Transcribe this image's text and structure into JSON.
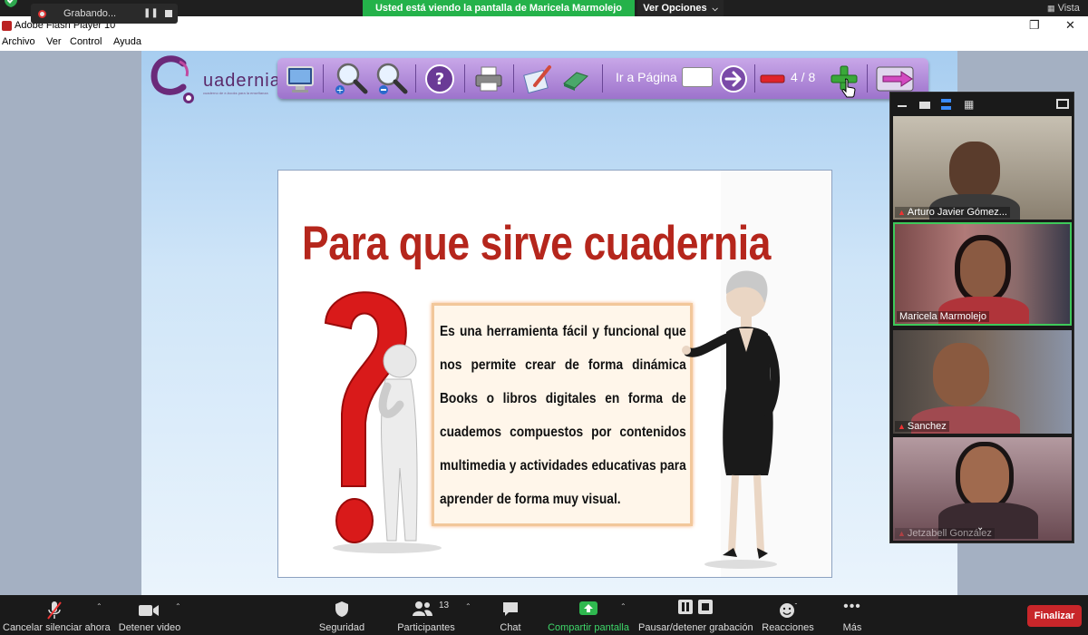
{
  "zoom": {
    "recording_label": "Grabando...",
    "banner": "Usted está viendo la pantalla de Maricela Marmolejo",
    "view_options": "Ver Opciones",
    "vista": "Vista"
  },
  "flash": {
    "title": "Adobe Flash Player 10",
    "menu": [
      "Archivo",
      "Ver",
      "Control",
      "Ayuda"
    ]
  },
  "cuadernia": {
    "logo_text": "uadernia",
    "logo_sub": "cuaderno de e-books para la enseñanza",
    "goto_label": "Ir a Página",
    "goto_value": "",
    "page_indicator": "4 / 8"
  },
  "slide": {
    "title": "Para que sirve cuadernia",
    "body": "Es una herramienta fácil y funcional que nos permite crear de forma dinámica Books o libros digitales en forma de cuademos compuestos por contenidos multimedia y actividades educativas para aprender de forma muy visual."
  },
  "participants": [
    {
      "name": "Arturo Javier Gómez...",
      "muted": true,
      "bg": "#8a8070"
    },
    {
      "name": "Maricela Marmolejo",
      "muted": false,
      "bg": "#9a5a55"
    },
    {
      "name": "Sanchez",
      "muted": true,
      "bg": "#6a6058"
    },
    {
      "name": "Jetzabell González",
      "muted": true,
      "bg": "#7a5a5e"
    }
  ],
  "bottom_bar": {
    "mute": "Cancelar silenciar ahora",
    "video": "Detener video",
    "security": "Seguridad",
    "participants": "Participantes",
    "participants_count": "13",
    "chat": "Chat",
    "share": "Compartir pantalla",
    "record": "Pausar/detener grabación",
    "reactions": "Reacciones",
    "more": "Más",
    "end": "Finalizar"
  },
  "colors": {
    "banner": "#24b24a",
    "toolbar": "#b08ad8",
    "title": "#b5261c",
    "end": "#c8262a"
  }
}
